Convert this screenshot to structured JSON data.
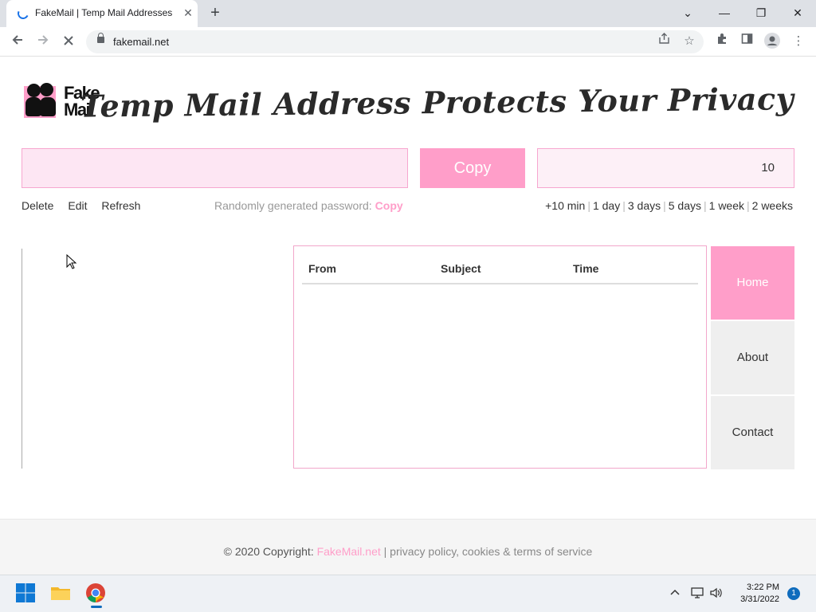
{
  "browser": {
    "tab_title": "FakeMail | Temp Mail Addresses",
    "tab_close": "✕",
    "new_tab": "+",
    "url": "fakemail.net",
    "window_controls": {
      "minimize": "—",
      "restore": "❐",
      "close": "✕",
      "dropdown": "⌄"
    }
  },
  "site": {
    "logo_text_line1": "Fake",
    "logo_text_line2": "Mail",
    "headline": "Temp Mail Address Protects Your Privacy",
    "email_value": "",
    "copy_label": "Copy",
    "timer_value": "10",
    "actions": [
      "Delete",
      "Edit",
      "Refresh"
    ],
    "password_label": "Randomly generated password:",
    "password_copy": "Copy",
    "extend": [
      "+10 min",
      "1 day",
      "3 days",
      "5 days",
      "1 week",
      "2 weeks"
    ],
    "inbox_columns": [
      "From",
      "Subject",
      "Time"
    ],
    "nav": [
      "Home",
      "About",
      "Contact"
    ],
    "footer_copyright": "© 2020 Copyright:",
    "footer_brand": "FakeMail.net",
    "footer_links": "| privacy policy, cookies & terms of service"
  },
  "taskbar": {
    "time": "3:22 PM",
    "date": "3/31/2022",
    "notifications": "1"
  },
  "colors": {
    "accent": "#ff9ec9",
    "accent_light": "#fde6f3",
    "nav_inactive": "#efefef"
  },
  "icons": [
    "back-arrow-icon",
    "forward-arrow-icon",
    "reload-icon",
    "lock-icon",
    "share-icon",
    "star-icon",
    "extensions-icon",
    "side-panel-icon",
    "profile-icon",
    "menu-icon",
    "windows-start-icon",
    "file-explorer-icon",
    "chrome-icon",
    "chevron-up-icon",
    "network-icon",
    "volume-icon"
  ]
}
